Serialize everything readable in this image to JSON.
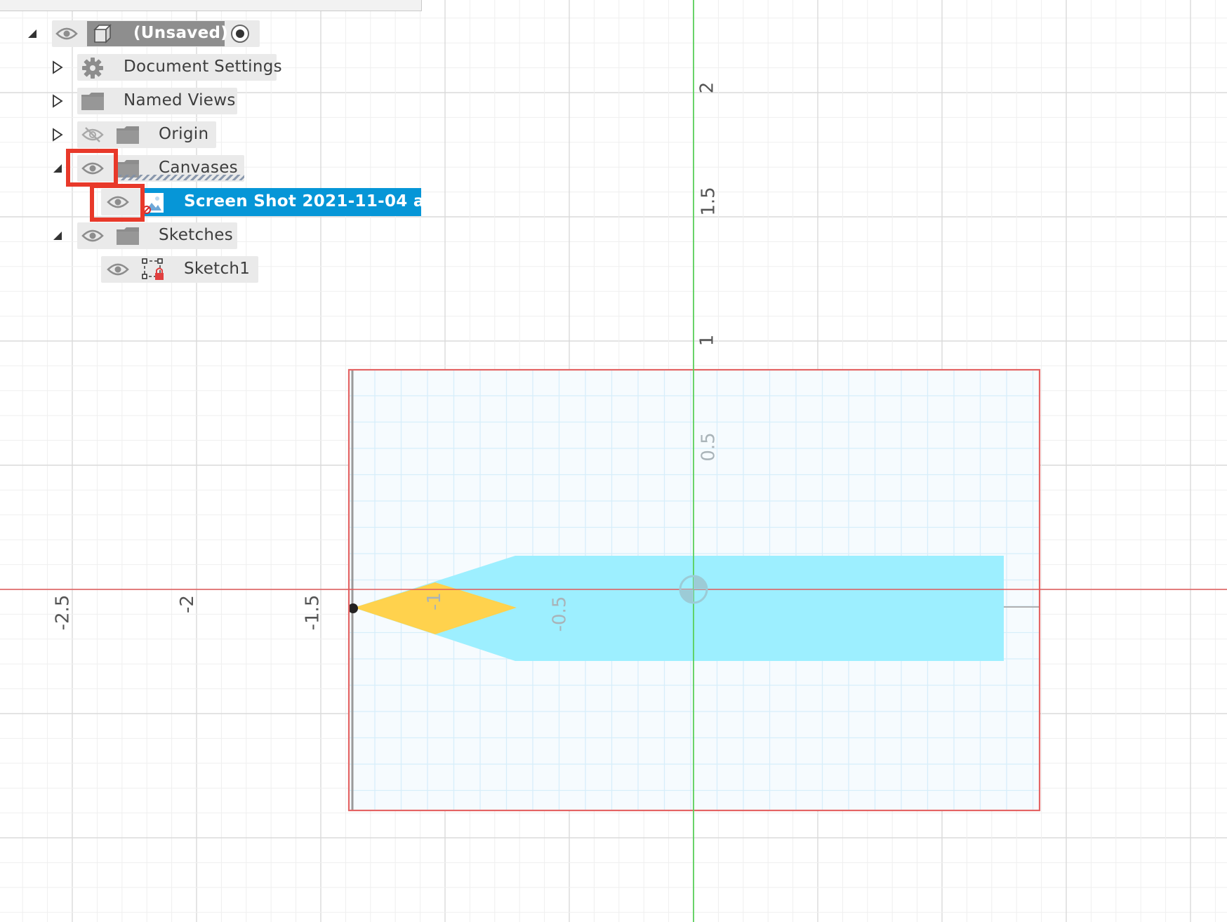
{
  "browser": {
    "root": {
      "label": "(Unsaved)"
    },
    "items": [
      {
        "id": "document-settings",
        "label": "Document Settings",
        "icon": "gear-icon"
      },
      {
        "id": "named-views",
        "label": "Named Views",
        "icon": "folder-icon"
      },
      {
        "id": "origin",
        "label": "Origin",
        "icon": "folder-icon",
        "visibility": "hidden-eye-icon"
      },
      {
        "id": "canvases",
        "label": "Canvases",
        "icon": "folder-icon",
        "visibility": "eye-icon"
      },
      {
        "id": "canvas-screenshot",
        "label": "Screen Shot 2021-11-04 a...",
        "icon": "image-icon",
        "visibility": "eye-icon",
        "selected": true
      },
      {
        "id": "sketches",
        "label": "Sketches",
        "icon": "folder-icon",
        "visibility": "eye-icon"
      },
      {
        "id": "sketch1",
        "label": "Sketch1",
        "icon": "sketch-icon",
        "visibility": "eye-icon"
      }
    ]
  },
  "viewport": {
    "x_axis_labels": [
      "-2.5",
      "-2",
      "-1.5",
      "-1",
      "-0.5"
    ],
    "y_axis_labels": [
      "2",
      "1.5",
      "1",
      "0.5"
    ]
  },
  "colors": {
    "selection": "#0696d7",
    "highlight": "#e8392a",
    "x_axis": "#e05a5a",
    "y_axis": "#5ad05a",
    "canvas_shape": "#9defff",
    "canvas_tip": "#ffd24d"
  }
}
